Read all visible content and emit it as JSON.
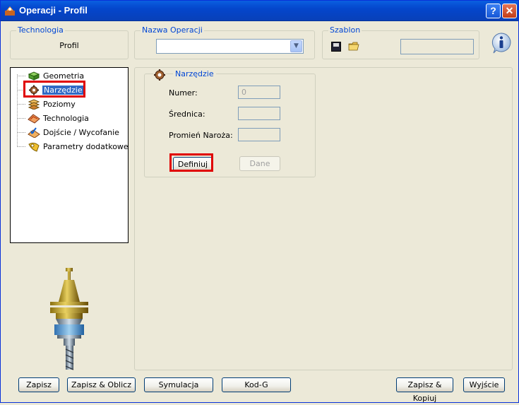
{
  "window": {
    "title": "Operacji - Profil",
    "help_label": "?",
    "close_label": "✕"
  },
  "technologia": {
    "label": "Technologia",
    "value": "Profil"
  },
  "nazwa_operacji": {
    "label": "Nazwa Operacji",
    "value": ""
  },
  "szablon": {
    "label": "Szablon",
    "value": ""
  },
  "tree": {
    "items": [
      {
        "label": "Geometria",
        "icon": "geometry-icon"
      },
      {
        "label": "Narzędzie",
        "icon": "tool-gear-icon",
        "selected": true
      },
      {
        "label": "Poziomy",
        "icon": "levels-icon"
      },
      {
        "label": "Technologia",
        "icon": "technology-icon"
      },
      {
        "label": "Dojście / Wycofanie",
        "icon": "approach-icon"
      },
      {
        "label": "Parametry dodatkowe",
        "icon": "extra-params-icon"
      }
    ]
  },
  "narzedzie": {
    "title": "Narzędzie",
    "numer_label": "Numer:",
    "numer_value": "0",
    "srednica_label": "Średnica:",
    "srednica_value": "",
    "promien_label": "Promień Naroża:",
    "promien_value": "",
    "definiuj_label": "Definiuj",
    "dane_label": "Dane"
  },
  "footer": {
    "zapisz": "Zapisz",
    "zapisz_oblicz": "Zapisz & Oblicz",
    "symulacja": "Symulacja",
    "kod_g": "Kod-G",
    "zapisz_kopiuj": "Zapisz & Kopiuj",
    "wyjscie": "Wyjście"
  },
  "colors": {
    "highlight": "#e00000",
    "selection": "#316ac5",
    "group_label": "#0046d5"
  }
}
